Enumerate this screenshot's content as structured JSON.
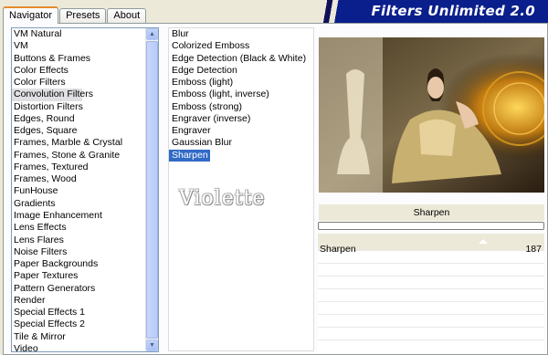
{
  "tabs": [
    "Navigator",
    "Presets",
    "About"
  ],
  "banner": "Filters Unlimited 2.0",
  "categories": {
    "items": [
      "VM Natural",
      "VM",
      "Buttons & Frames",
      "Color Effects",
      "Color Filters",
      "Convolution Filters",
      "Distortion Filters",
      "Edges, Round",
      "Edges, Square",
      "Frames, Marble & Crystal",
      "Frames, Stone & Granite",
      "Frames, Textured",
      "Frames, Wood",
      "FunHouse",
      "Gradients",
      "Image Enhancement",
      "Lens Effects",
      "Lens Flares",
      "Noise Filters",
      "Paper Backgrounds",
      "Paper Textures",
      "Pattern Generators",
      "Render",
      "Special Effects 1",
      "Special Effects 2",
      "Tile & Mirror",
      "Video"
    ],
    "selected_index": 5
  },
  "filters": {
    "items": [
      "Blur",
      "Colorized Emboss",
      "Edge Detection (Black & White)",
      "Edge Detection",
      "Emboss (light)",
      "Emboss (light, inverse)",
      "Emboss (strong)",
      "Engraver (inverse)",
      "Engraver",
      "Gaussian Blur",
      "Sharpen"
    ],
    "selected_index": 10
  },
  "watermark": "Violette",
  "preview_icon": "woman-with-lamp-artwork",
  "param_header": "Sharpen",
  "progress": 0,
  "parameter": {
    "label": "Sharpen",
    "value": "187"
  },
  "colors": {
    "selection": "#316ac5",
    "banner": "#0a1e8c",
    "tab_highlight": "#e68b2c"
  }
}
